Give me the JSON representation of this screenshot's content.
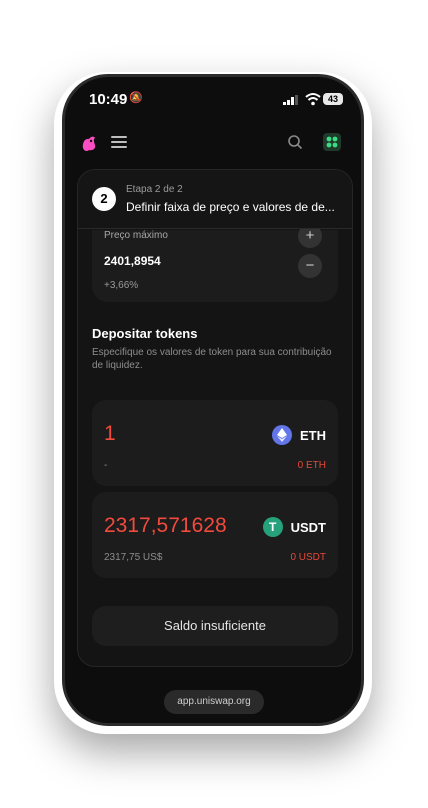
{
  "status_bar": {
    "time": "10:49",
    "battery": "43"
  },
  "step": {
    "number": "2",
    "label": "Etapa 2 de 2",
    "title": "Definir faixa de preço e valores de de..."
  },
  "price_range": {
    "label": "Preço máximo",
    "value": "2401,8954",
    "change": "+3,66%",
    "plus_symbol": "+",
    "minus_symbol": "−"
  },
  "deposit": {
    "title": "Depositar tokens",
    "description": "Especifique os valores de token para sua contribuição de liquidez.",
    "tokens": [
      {
        "amount": "1",
        "symbol": "ETH",
        "usd_value": "-",
        "balance": "0 ETH",
        "icon": "eth-icon",
        "color": "#6276ea"
      },
      {
        "amount": "2317,571628",
        "symbol": "USDT",
        "usd_value": "2317,75 US$",
        "balance": "0 USDT",
        "icon": "usdt-icon",
        "icon_glyph": "T",
        "color": "#26a17b"
      }
    ]
  },
  "cta_label": "Saldo insuficiente",
  "url": "app.uniswap.org",
  "colors": {
    "amount": "#f24a3c",
    "background": "#0d0d0d",
    "card": "#1c1c1c"
  }
}
